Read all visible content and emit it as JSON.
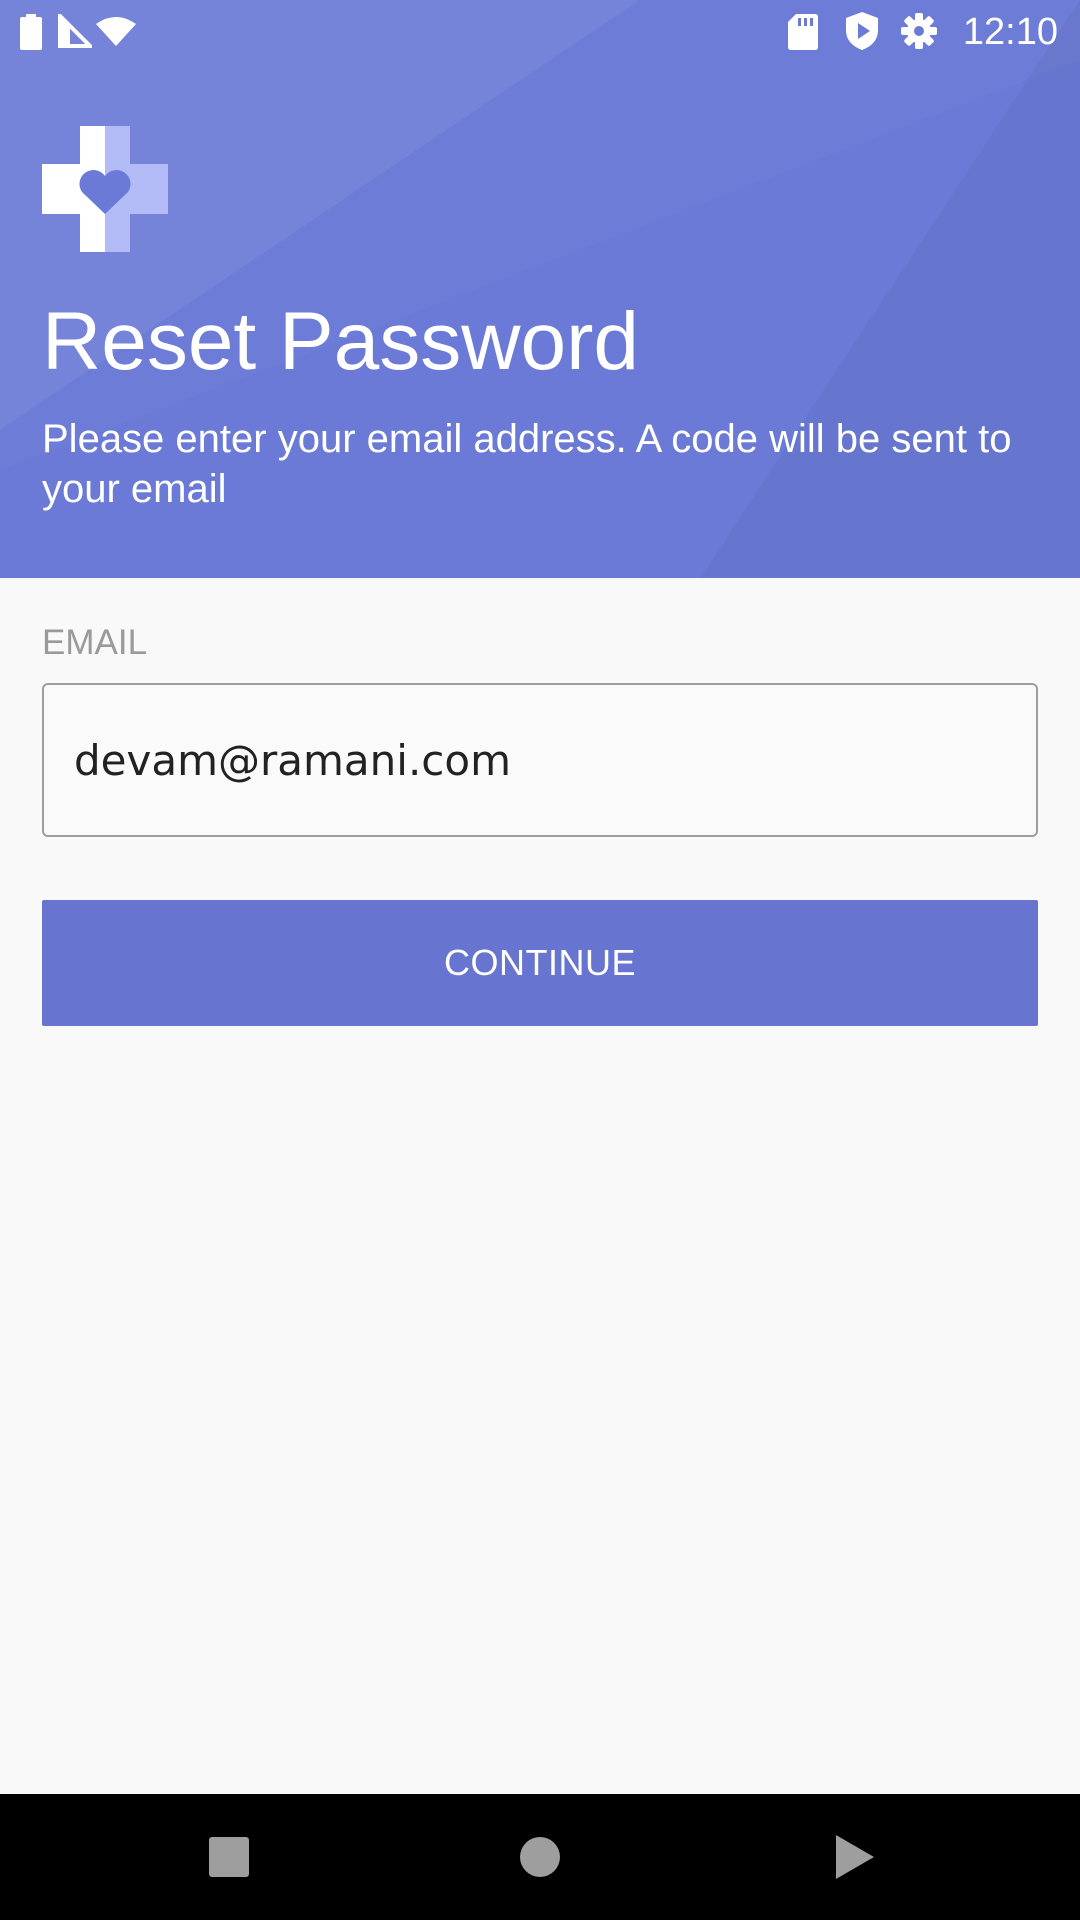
{
  "status_bar": {
    "time": "12:10",
    "icons": [
      "battery-icon",
      "cell-signal-icon",
      "wifi-icon",
      "sd-card-icon",
      "shield-play-icon",
      "gear-icon"
    ]
  },
  "header": {
    "logo": "medical-cross-heart-logo",
    "title": "Reset Password",
    "subtitle": "Please enter your email address. A code will be sent to your email"
  },
  "form": {
    "email_label": "EMAIL",
    "email_value": "devam@ramani.com",
    "continue_label": "CONTINUE"
  },
  "nav_bar": {
    "buttons": [
      "recents-square-icon",
      "home-circle-icon",
      "back-triangle-icon"
    ]
  },
  "colors": {
    "header_bg": "#6b7ad6",
    "accent": "#6775d1",
    "logo_light": "#b4bcf8",
    "page_bg": "#f9f9f9"
  }
}
